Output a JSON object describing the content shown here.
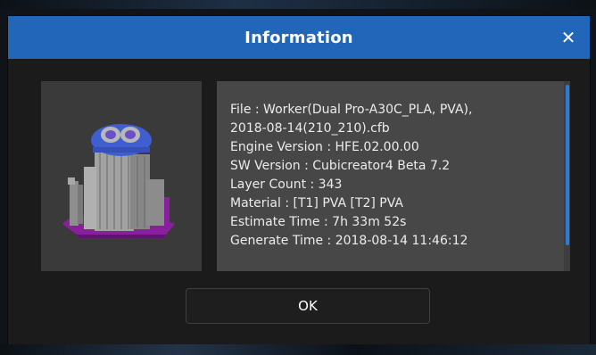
{
  "dialog": {
    "title": "Information",
    "close_label": "✕",
    "ok_label": "OK"
  },
  "info": {
    "lines": [
      "File : Worker(Dual Pro-A30C_PLA, PVA),",
      "2018-08-14(210_210).cfb",
      "Engine Version : HFE.02.00.00",
      "SW Version : Cubicreator4 Beta 7.2",
      "Layer Count : 343",
      "Material : [T1] PVA  [T2] PVA",
      "Estimate Time : 7h 33m 52s",
      "Generate Time : 2018-08-14 11:46:12"
    ]
  },
  "colors": {
    "titlebar": "#2166b9",
    "dialog_bg": "#1b1b1b",
    "info_bg": "#474747",
    "thumb_bg": "#3a3a3a",
    "scroll_accent": "#2e7bd6",
    "model_support": "#8a1f9e",
    "model_body": "#9a9a9a",
    "model_top": "#3f5fd0"
  },
  "thumbnail": {
    "icon": "3d-model-preview"
  }
}
